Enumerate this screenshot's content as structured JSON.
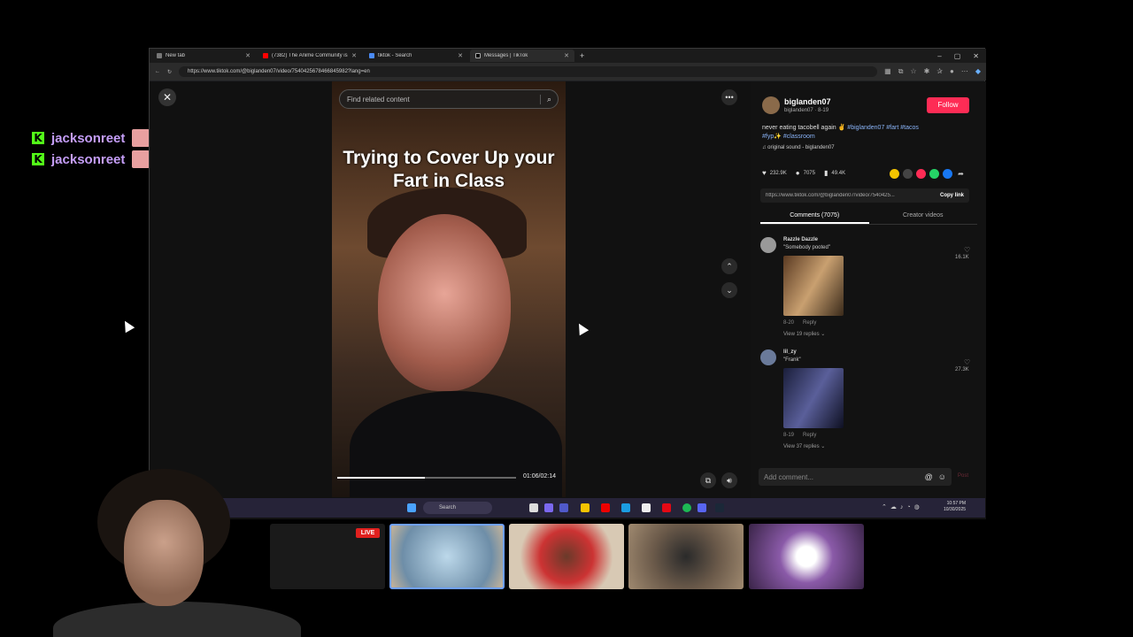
{
  "overlay_chat": [
    {
      "user": "jacksonreet"
    },
    {
      "user": "jacksonreet"
    }
  ],
  "browser": {
    "tabs": [
      {
        "label": "New tab",
        "active": false
      },
      {
        "label": "(7382) The Anime Community is t...",
        "active": false
      },
      {
        "label": "tiktok - Search",
        "active": false
      },
      {
        "label": "Messages | TikTok",
        "active": true
      }
    ],
    "new_tab": "+",
    "url": "https://www.tiktok.com/@biglanden07/video/7540425678466845982?lang=en"
  },
  "video": {
    "search_placeholder": "Find related content",
    "caption": "Trying to Cover Up your Fart in Class",
    "time": "01:06/02:14",
    "progress": 0.49
  },
  "post": {
    "author": "biglanden07",
    "author_sub": "biglanden07 · 8-19",
    "follow": "Follow",
    "desc_text": "never eating tacobell again ✌",
    "tags_line1": "#biglanden07 #fart #tacos",
    "tags_line2": "#fyp✨ #classroom",
    "sound": "♫  original sound - biglanden07",
    "likes": "232.9K",
    "comments": "7075",
    "saves": "49.4K",
    "link": "https://www.tiktok.com/@biglanden07/video/7540425...",
    "copy_link": "Copy link",
    "tab_comments": "Comments (7075)",
    "tab_creator": "Creator videos"
  },
  "comments": [
    {
      "name": "Razzle Dazzle",
      "text": "\"Somebody pooted\"",
      "date": "8-20",
      "reply": "Reply",
      "view_replies": "View 19 replies ⌄",
      "likes": "16.1K"
    },
    {
      "name": "lil_zy",
      "text": "\"Frank\"",
      "date": "8-19",
      "reply": "Reply",
      "view_replies": "View 37 replies ⌄",
      "likes": "27.3K"
    }
  ],
  "add_comment": {
    "placeholder": "Add comment...",
    "post": "Post"
  },
  "taskbar": {
    "search": "Search",
    "time": "10:57 PM",
    "date": "10/30/2025"
  },
  "live_badge": "LIVE",
  "colors": {
    "follow": "#fe2c55",
    "kick": "#53fc18",
    "chat_name": "#c59ef7",
    "hashtag": "#8ab4f8"
  }
}
